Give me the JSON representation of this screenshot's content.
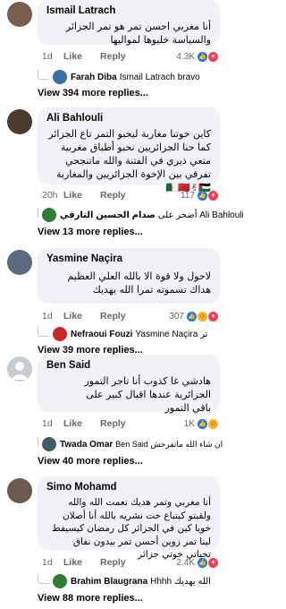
{
  "actions": {
    "like": "Like",
    "reply": "Reply"
  },
  "comments": [
    {
      "author": "Ismail Latrach",
      "text": "أنا مغربي احسن تمر هو تمر الجزائر والسياسة خليوها لمواليها",
      "time": "1d",
      "reaction_count": "4.3K",
      "reply_name": "Farah Diba",
      "reply_text": "Ismail Latrach bravo",
      "view_more": "View 394 more replies..."
    },
    {
      "author": "Ali Bahlouli",
      "text": "كاين خوتنا مغاربة ليحبو التمر تاع الجزائر كما حنا الجزائريين نحبو أطباق مغربية متعي ذيري في الفتنة والله ماتنجحي تفرقي بين الإخوة الجزائريين والمغاربة 🇩🇿🇲🇦✌🇵🇸",
      "time": "20h",
      "reaction_count": "117",
      "reply_name": "صدام الحسين التارقي",
      "reply_text": "Ali Bahlouli أضحر على",
      "view_more": "View 13 more replies..."
    },
    {
      "author": "Yasmine Naçira",
      "text": "لاحول ولا قوة الا بالله العلي العظيم هداك تسموته تمرا الله يهديك",
      "time": "1d",
      "reaction_count": "307",
      "reply_name": "Nefraoui Fouzi",
      "reply_text": "Yasmine Naçira تر",
      "view_more": "View 39 more replies..."
    },
    {
      "author": "Ben Said",
      "text": "هادشي غا كذوب أنا تاجر التمور الجزائرية عندها اقبال كبير على باقي التمور",
      "time": "1d",
      "reaction_count": "1K",
      "reply_name": "Twada Omar",
      "reply_text": "Ben Said ان شاء الله ماتفرحش",
      "view_more": "View 40 more replies..."
    },
    {
      "author": "Simo Mohamd",
      "text": "أنا مغربي وتمر هديك نعمت الله والله ولقيتو كيتباع حت نشريه بالله أنا أصلان خويا كين في الجزائر كل رمضان كيسيفط لينا تمر زوين أحسن تمر بيدون نفاق تحياتي خوتي جزائر",
      "time": "1d",
      "reaction_count": "2.4K",
      "reply_name": "Brahim Blaugrana",
      "reply_text": "Hhhh الله يهديك",
      "view_more": "View 88 more replies..."
    }
  ]
}
